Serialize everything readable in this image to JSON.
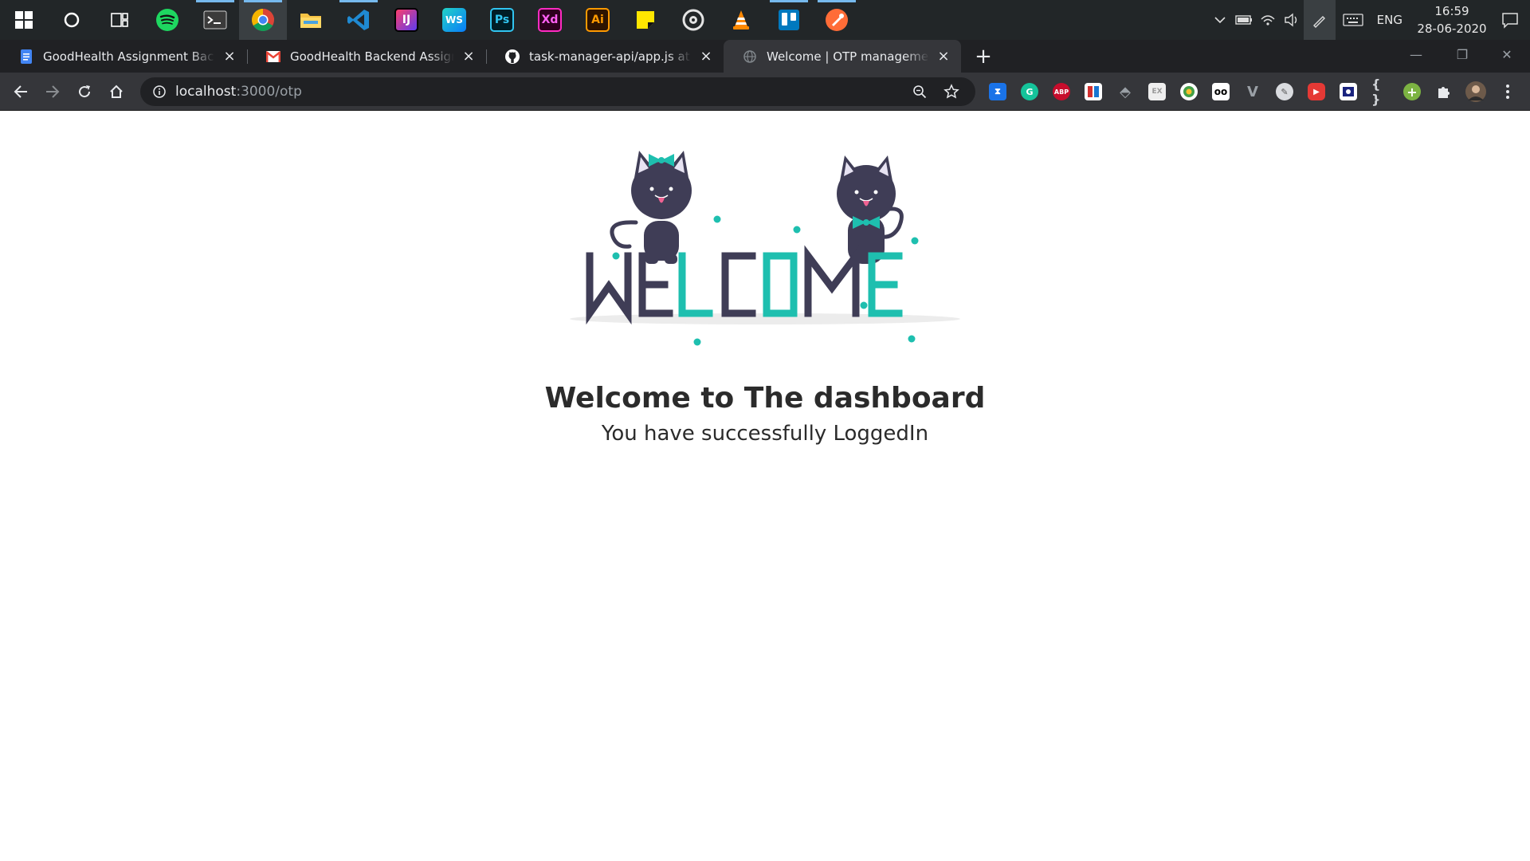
{
  "taskbar": {
    "apps": [
      {
        "name": "windows-start",
        "icon": "windows-logo-icon"
      },
      {
        "name": "cortana",
        "icon": "cortana-ring-icon"
      },
      {
        "name": "task-view",
        "icon": "task-view-icon"
      },
      {
        "name": "spotify",
        "icon": "spotify-icon"
      },
      {
        "name": "terminal",
        "icon": "terminal-icon"
      },
      {
        "name": "chrome",
        "icon": "chrome-icon"
      },
      {
        "name": "file-explorer",
        "icon": "folder-icon"
      },
      {
        "name": "vscode",
        "icon": "vscode-icon"
      },
      {
        "name": "intellij",
        "icon": "intellij-icon",
        "label": "IJ"
      },
      {
        "name": "webstorm",
        "icon": "webstorm-icon",
        "label": "WS"
      },
      {
        "name": "photoshop",
        "icon": "photoshop-icon",
        "label": "Ps"
      },
      {
        "name": "adobe-xd",
        "icon": "xd-icon",
        "label": "Xd"
      },
      {
        "name": "illustrator",
        "icon": "illustrator-icon",
        "label": "Ai"
      },
      {
        "name": "sticky-notes",
        "icon": "sticky-notes-icon"
      },
      {
        "name": "media-player",
        "icon": "disc-icon"
      },
      {
        "name": "vlc",
        "icon": "vlc-cone-icon"
      },
      {
        "name": "trello",
        "icon": "trello-icon"
      },
      {
        "name": "postman",
        "icon": "postman-icon"
      }
    ],
    "tray": {
      "language": "ENG",
      "time": "16:59",
      "date": "28-06-2020"
    }
  },
  "browser": {
    "tabs": [
      {
        "title": "GoodHealth Assignment Backend",
        "favicon": "google-docs-icon"
      },
      {
        "title": "GoodHealth Backend Assignment",
        "favicon": "gmail-icon"
      },
      {
        "title": "task-manager-api/app.js at master",
        "favicon": "github-icon"
      },
      {
        "title": "Welcome | OTP management System",
        "favicon": "loading-globe-icon"
      }
    ],
    "url_host": "localhost",
    "url_path": ":3000/otp",
    "extensions": [
      "timer-extension",
      "grammarly-extension",
      "adblock-plus-extension",
      "color-extension",
      "stylus-extension",
      "exif-extension",
      "speedtest-extension",
      "incognito-extension",
      "vue-devtools-extension",
      "page-ruler-extension",
      "youtube-extension",
      "screen-capture-extension",
      "json-formatter-extension",
      "plus-extension",
      "extensions-puzzle",
      "profile-avatar"
    ]
  },
  "page": {
    "hero_word": "WELCOME",
    "heading": "Welcome to The dashboard",
    "subheading": "You have successfully LoggedIn"
  },
  "colors": {
    "accent_teal": "#1ebfaf",
    "cat_dark": "#3f3d56",
    "tongue_pink": "#f06292"
  }
}
